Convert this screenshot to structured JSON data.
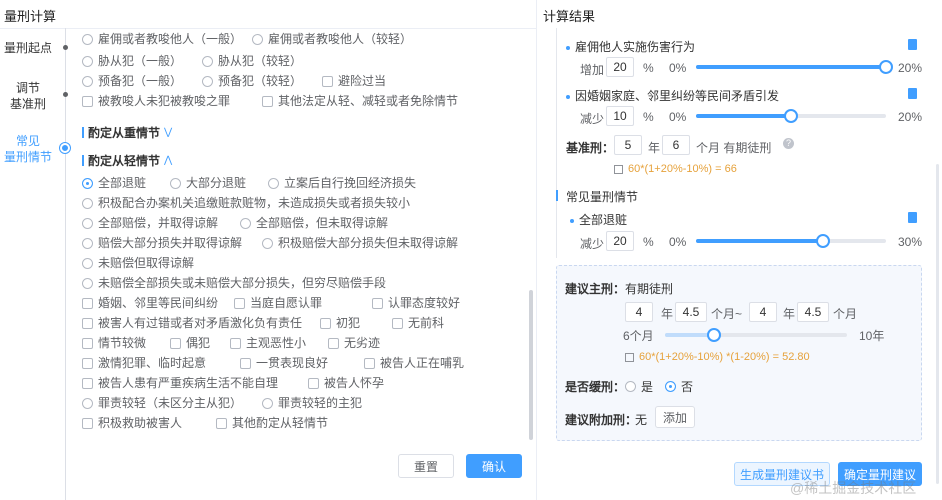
{
  "left_title": "量刑计算",
  "right_title": "计算结果",
  "nav": {
    "items": [
      "量刑起点",
      "调节基准刑",
      "常见量刑情节"
    ],
    "item1": "量刑起点",
    "item2a": "调节",
    "item2b": "基准刑",
    "item3a": "常见",
    "item3b": "量刑情节"
  },
  "top_row": {
    "a": "雇佣或者教唆他人（一般）",
    "b": "雇佣或者教唆他人（较轻）"
  },
  "accomplice": {
    "a": "胁从犯（一般）",
    "b": "胁从犯（较轻）"
  },
  "preparation": {
    "a": "预备犯（一般）",
    "b": "预备犯（较轻）",
    "c": "避险过当"
  },
  "instigated": {
    "a": "被教唆人未犯被教唆之罪",
    "b": "其他法定从轻、减轻或者免除情节"
  },
  "heavier_title": "酌定从重情节",
  "lighter_title": "酌定从轻情节",
  "lighter": {
    "r1a": "全部退赃",
    "r1b": "大部分退赃",
    "r1c": "立案后自行挽回经济损失",
    "r2": "积极配合办案机关追缴赃款赃物，未造成损失或者损失较小",
    "r3a": "全部赔偿，并取得谅解",
    "r3b": "全部赔偿，但未取得谅解",
    "r4a": "赔偿大部分损失并取得谅解",
    "r4b": "积极赔偿大部分损失但未取得谅解",
    "r5": "未赔偿但取得谅解",
    "r6": "未赔偿全部损失或未赔偿大部分损失，但穷尽赔偿手段",
    "c1a": "婚姻、邻里等民间纠纷",
    "c1b": "当庭自愿认罪",
    "c1c": "认罪态度较好",
    "c2a": "被害人有过错或者对矛盾激化负有责任",
    "c2b": "初犯",
    "c2c": "无前科",
    "c3a": "情节较微",
    "c3b": "偶犯",
    "c3c": "主观恶性小",
    "c3d": "无劣迹",
    "c4a": "激情犯罪、临时起意",
    "c4b": "一贯表现良好",
    "c4c": "被告人正在哺乳",
    "c5a": "被告人患有严重疾病生活不能自理",
    "c5b": "被告人怀孕",
    "r7a": "罪责较轻（未区分主从犯）",
    "r7b": "罪责较轻的主犯",
    "c6a": "积极救助被害人",
    "c6b": "其他酌定从轻情节"
  },
  "reset_label": "重置",
  "confirm_label": "确认",
  "result": {
    "f1_name": "雇佣他人实施伤害行为",
    "f1_dir": "增加",
    "f1_val": "20",
    "pct": "%",
    "zero": "0%",
    "f1_max": "20%",
    "f1_level": 1.0,
    "f2_name": "因婚姻家庭、邻里纠纷等民间矛盾引发",
    "f2_dir": "减少",
    "f2_val": "10",
    "f2_max": "20%",
    "f2_level": 0.5,
    "base_label": "基准刑：",
    "base_years": "5",
    "year": "年",
    "base_months": "6",
    "month_text": "个月 有期徒刑",
    "base_formula": "60*(1+20%-10%) = 66",
    "common_title": "常见量刑情节",
    "f3_name": "全部退赃",
    "f3_dir": "减少",
    "f3_val": "20",
    "f3_max": "30%",
    "f3_level": 0.6667,
    "main_label": "建议主刑：",
    "main_type": "有期徒刑",
    "y1": "4",
    "m1": "4.5",
    "month": "个月",
    "tilde": "~",
    "y2": "4",
    "m2": "4.5",
    "range_min": "6个月",
    "range_max": "10年",
    "range_level": 0.27,
    "main_formula": "60*(1+20%-10%) *(1-20%) = 52.80",
    "probation_label": "是否缓刑：",
    "yes": "是",
    "no": "否",
    "extra_label": "建议附加刑：",
    "extra_value": "无",
    "add_label": "添加",
    "gen_doc_label": "生成量刑建议书",
    "confirm_suggest_label": "确定量刑建议"
  },
  "watermark": "@稀土掘金技术社区",
  "colors": {
    "accent": "#409eff",
    "formula": "#e6a23c"
  }
}
